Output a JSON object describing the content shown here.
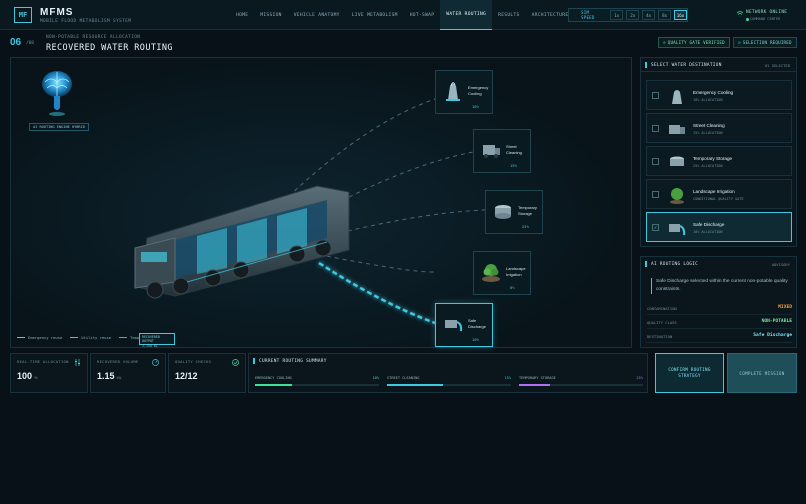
{
  "header": {
    "logo": "MF",
    "title": "MFMS",
    "subtitle": "MOBILE FLOOD METABOLISM SYSTEM",
    "nav": [
      "HOME",
      "MISSION",
      "VEHICLE ANATOMY",
      "LIVE METABOLISM",
      "HOT-SWAP",
      "WATER ROUTING",
      "RESULTS",
      "ARCHITECTURE",
      "FEEDBACK"
    ],
    "active_nav": "WATER ROUTING",
    "sim_speed_label": "SIM SPEED",
    "speeds": [
      "1x",
      "2x",
      "4x",
      "8x",
      "16x"
    ],
    "active_speed": "16x",
    "network_status": "NETWORK ONLINE",
    "network_sub": "COMMAND CENTER"
  },
  "section": {
    "step": "06",
    "step_total": "/08",
    "kicker": "NON-POTABLE RESOURCE ALLOCATION",
    "title": "RECOVERED WATER ROUTING",
    "badge_quality": "QUALITY GATE VERIFIED",
    "badge_selection": "SELECTION REQUIRED"
  },
  "scene": {
    "ai_label": "AI ROUTING ENGINE HYBRID",
    "cards": [
      {
        "name": "Emergency Cooling",
        "pct": "10%",
        "icon": "cooling-tower-icon"
      },
      {
        "name": "Street Cleaning",
        "pct": "15%",
        "icon": "street-sweeper-icon"
      },
      {
        "name": "Temporary Storage",
        "pct": "25%",
        "icon": "storage-tank-icon"
      },
      {
        "name": "Landscape Irrigation",
        "pct": "0%",
        "icon": "plant-icon"
      },
      {
        "name": "Safe Discharge",
        "pct": "10%",
        "icon": "discharge-outlet-icon"
      }
    ],
    "legend": [
      "Emergency reuse",
      "Utility reuse",
      "Temporary storage"
    ],
    "output_label": "RECOVERED OUTPUT",
    "output_value": "1,150 BL"
  },
  "side": {
    "title": "SELECT WATER DESTINATION",
    "meta": "01 SELECTED",
    "options": [
      {
        "name": "Emergency Cooling",
        "sub": "10% ALLOCATION",
        "check": ""
      },
      {
        "name": "Street Cleaning",
        "sub": "15% ALLOCATION",
        "check": ""
      },
      {
        "name": "Temporary Storage",
        "sub": "25% ALLOCATION",
        "check": ""
      },
      {
        "name": "Landscape Irrigation",
        "sub": "CONDITIONAL QUALITY GATE",
        "check": ""
      },
      {
        "name": "Safe Discharge",
        "sub": "10% ALLOCATION",
        "check": "✓"
      }
    ]
  },
  "logic": {
    "title": "AI ROUTING LOGIC",
    "meta": "ADVISORY",
    "description": "Safe Discharge selected within the current non-potable quality constraints.",
    "rows": [
      {
        "key": "CONTAMINATION",
        "value": "MIXED",
        "color": "#f0a040"
      },
      {
        "key": "QUALITY CLASS",
        "value": "NON-POTABLE",
        "color": "#7fe0a0"
      },
      {
        "key": "DESTINATION",
        "value": "Safe Discharge",
        "color": "#7fe6f6"
      }
    ]
  },
  "stats": [
    {
      "label": "REAL-TIME ALLOCATION",
      "value": "100",
      "unit": "%"
    },
    {
      "label": "RECOVERED VOLUME",
      "value": "1.15",
      "unit": "ML"
    },
    {
      "label": "QUALITY CHECKS",
      "value": "12/12",
      "unit": ""
    }
  ],
  "summary": {
    "title": "CURRENT ROUTING SUMMARY",
    "items": [
      {
        "label": "EMERGENCY COOLING",
        "pct": "10%",
        "fraction": 0.3,
        "color": "#3ee09a"
      },
      {
        "label": "STREET CLEANING",
        "pct": "15%",
        "fraction": 0.45,
        "color": "#3ec9e0"
      },
      {
        "label": "TEMPORARY STORAGE",
        "pct": "25%",
        "fraction": 0.25,
        "color": "#b070f0"
      }
    ]
  },
  "actions": {
    "confirm": "CONFIRM ROUTING STRATEGY",
    "complete": "COMPLETE MISSION"
  }
}
